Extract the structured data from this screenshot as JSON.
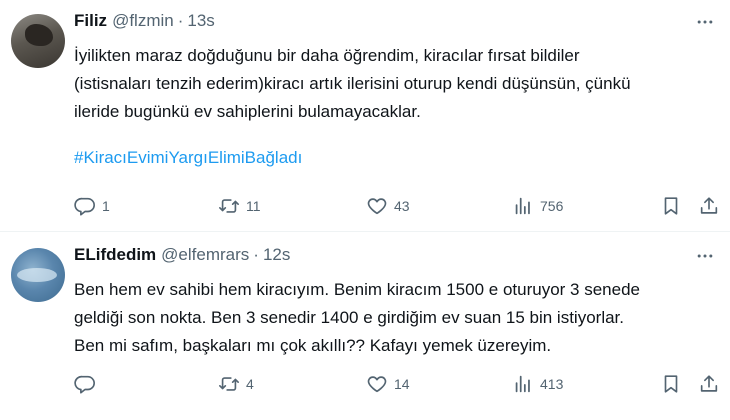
{
  "tweets": [
    {
      "name": "Filiz",
      "handle": "@flzmin",
      "separator": "·",
      "time": "13s",
      "lines": [
        "İyilikten maraz doğduğunu bir daha öğrendim, kiracılar fırsat bildiler",
        "(istisnaları tenzih ederim)kiracı artık ilerisini oturup kendi düşünsün, çünkü",
        "ileride bugünkü ev sahiplerini bulamayacaklar."
      ],
      "hashtag": "#KiracıEvimiYargıElimiBağladı",
      "reply_count": "1",
      "retweet_count": "11",
      "like_count": "43",
      "view_count": "756"
    },
    {
      "name": "ELifdedim",
      "handle": "@elfemrars",
      "separator": "·",
      "time": "12s",
      "lines": [
        "Ben hem ev sahibi hem kiracıyım. Benim kiracım 1500 e oturuyor 3 senede",
        "geldiği son nokta. Ben 3 senedir 1400 e girdiğim ev suan 15 bin istiyorlar.",
        "Ben mi safım, başkaları mı çok akıllı??  Kafayı yemek üzereyim."
      ],
      "reply_count": "",
      "retweet_count": "4",
      "like_count": "14",
      "view_count": "413"
    }
  ],
  "icons": {
    "reply": "reply-icon",
    "retweet": "retweet-icon",
    "like": "like-icon",
    "views": "views-icon",
    "bookmark": "bookmark-icon",
    "share": "share-icon",
    "more": "more-icon"
  },
  "colors": {
    "text": "#0f1419",
    "secondary": "#536471",
    "hashtag": "#1d9bf0",
    "divider": "#eff3f4"
  }
}
